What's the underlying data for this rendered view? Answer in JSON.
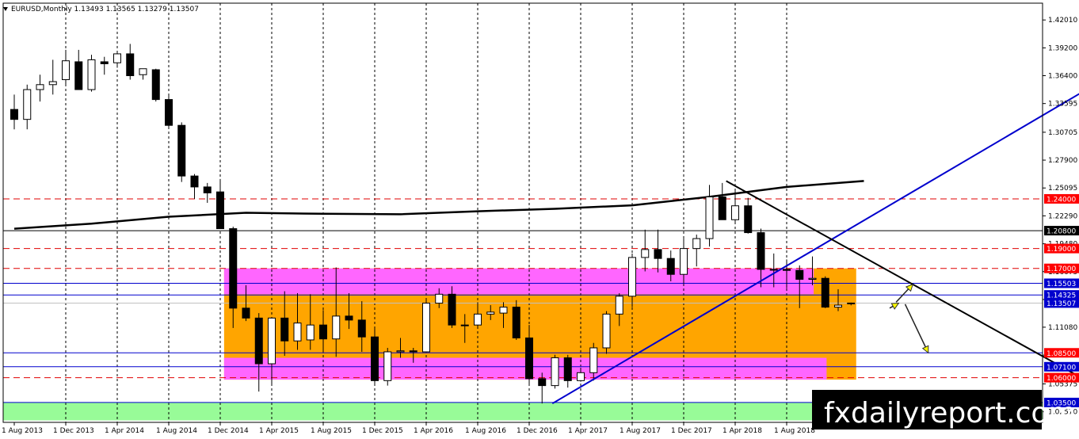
{
  "chart_data": {
    "type": "candlestick",
    "title": "EURUSD,Monthly  1.13493 1.13565 1.13279 1.13507",
    "watermark": "fxdailyreport.com",
    "y_ticks": [
      "1.42010",
      "1.39200",
      "1.36400",
      "1.33595",
      "1.30705",
      "1.27900",
      "1.25095",
      "1.22290",
      "1.19480",
      "1.16675",
      "1.13870",
      "1.11080",
      "1.08270",
      "1.05375",
      "1.02570"
    ],
    "x_ticks": [
      "1 Aug 2013",
      "1 Dec 2013",
      "1 Apr 2014",
      "1 Aug 2014",
      "1 Dec 2014",
      "1 Apr 2015",
      "1 Aug 2015",
      "1 Dec 2015",
      "1 Apr 2016",
      "1 Aug 2016",
      "1 Dec 2016",
      "1 Apr 2017",
      "1 Aug 2017",
      "1 Dec 2017",
      "1 Apr 2018",
      "1 Aug 2018"
    ],
    "ylim": [
      1.015,
      1.437
    ],
    "candles": [
      {
        "o": 1.33,
        "h": 1.345,
        "l": 1.31,
        "c": 1.32
      },
      {
        "o": 1.32,
        "h": 1.355,
        "l": 1.31,
        "c": 1.35
      },
      {
        "o": 1.35,
        "h": 1.365,
        "l": 1.338,
        "c": 1.355
      },
      {
        "o": 1.355,
        "h": 1.38,
        "l": 1.345,
        "c": 1.358
      },
      {
        "o": 1.36,
        "h": 1.39,
        "l": 1.354,
        "c": 1.379
      },
      {
        "o": 1.378,
        "h": 1.39,
        "l": 1.35,
        "c": 1.35
      },
      {
        "o": 1.35,
        "h": 1.385,
        "l": 1.348,
        "c": 1.38
      },
      {
        "o": 1.378,
        "h": 1.383,
        "l": 1.365,
        "c": 1.376
      },
      {
        "o": 1.377,
        "h": 1.388,
        "l": 1.372,
        "c": 1.386
      },
      {
        "o": 1.386,
        "h": 1.396,
        "l": 1.36,
        "c": 1.364
      },
      {
        "o": 1.365,
        "h": 1.371,
        "l": 1.36,
        "c": 1.371
      },
      {
        "o": 1.37,
        "h": 1.371,
        "l": 1.338,
        "c": 1.34
      },
      {
        "o": 1.34,
        "h": 1.345,
        "l": 1.312,
        "c": 1.314
      },
      {
        "o": 1.314,
        "h": 1.317,
        "l": 1.257,
        "c": 1.263
      },
      {
        "o": 1.263,
        "h": 1.265,
        "l": 1.24,
        "c": 1.252
      },
      {
        "o": 1.252,
        "h": 1.256,
        "l": 1.236,
        "c": 1.246
      },
      {
        "o": 1.247,
        "h": 1.26,
        "l": 1.21,
        "c": 1.21
      },
      {
        "o": 1.21,
        "h": 1.212,
        "l": 1.11,
        "c": 1.13
      },
      {
        "o": 1.13,
        "h": 1.153,
        "l": 1.117,
        "c": 1.12
      },
      {
        "o": 1.12,
        "h": 1.125,
        "l": 1.046,
        "c": 1.074
      },
      {
        "o": 1.074,
        "h": 1.119,
        "l": 1.052,
        "c": 1.12
      },
      {
        "o": 1.12,
        "h": 1.147,
        "l": 1.082,
        "c": 1.097
      },
      {
        "o": 1.097,
        "h": 1.145,
        "l": 1.088,
        "c": 1.115
      },
      {
        "o": 1.098,
        "h": 1.144,
        "l": 1.088,
        "c": 1.113
      },
      {
        "o": 1.113,
        "h": 1.128,
        "l": 1.086,
        "c": 1.099
      },
      {
        "o": 1.099,
        "h": 1.171,
        "l": 1.081,
        "c": 1.122
      },
      {
        "o": 1.122,
        "h": 1.145,
        "l": 1.109,
        "c": 1.118
      },
      {
        "o": 1.118,
        "h": 1.137,
        "l": 1.086,
        "c": 1.101
      },
      {
        "o": 1.101,
        "h": 1.11,
        "l": 1.052,
        "c": 1.057
      },
      {
        "o": 1.057,
        "h": 1.09,
        "l": 1.052,
        "c": 1.086
      },
      {
        "o": 1.086,
        "h": 1.1,
        "l": 1.08,
        "c": 1.087
      },
      {
        "o": 1.087,
        "h": 1.09,
        "l": 1.075,
        "c": 1.086
      },
      {
        "o": 1.086,
        "h": 1.138,
        "l": 1.086,
        "c": 1.135
      },
      {
        "o": 1.135,
        "h": 1.15,
        "l": 1.13,
        "c": 1.144
      },
      {
        "o": 1.144,
        "h": 1.152,
        "l": 1.11,
        "c": 1.113
      },
      {
        "o": 1.113,
        "h": 1.124,
        "l": 1.095,
        "c": 1.113
      },
      {
        "o": 1.113,
        "h": 1.136,
        "l": 1.11,
        "c": 1.124
      },
      {
        "o": 1.124,
        "h": 1.133,
        "l": 1.118,
        "c": 1.126
      },
      {
        "o": 1.125,
        "h": 1.136,
        "l": 1.11,
        "c": 1.131
      },
      {
        "o": 1.131,
        "h": 1.138,
        "l": 1.098,
        "c": 1.1
      },
      {
        "o": 1.1,
        "h": 1.113,
        "l": 1.052,
        "c": 1.059
      },
      {
        "o": 1.059,
        "h": 1.065,
        "l": 1.034,
        "c": 1.052
      },
      {
        "o": 1.052,
        "h": 1.083,
        "l": 1.049,
        "c": 1.08
      },
      {
        "o": 1.08,
        "h": 1.083,
        "l": 1.05,
        "c": 1.057
      },
      {
        "o": 1.057,
        "h": 1.07,
        "l": 1.056,
        "c": 1.065
      },
      {
        "o": 1.065,
        "h": 1.095,
        "l": 1.057,
        "c": 1.09
      },
      {
        "o": 1.09,
        "h": 1.127,
        "l": 1.084,
        "c": 1.124
      },
      {
        "o": 1.124,
        "h": 1.145,
        "l": 1.112,
        "c": 1.142
      },
      {
        "o": 1.142,
        "h": 1.185,
        "l": 1.131,
        "c": 1.181
      },
      {
        "o": 1.181,
        "h": 1.209,
        "l": 1.167,
        "c": 1.189
      },
      {
        "o": 1.189,
        "h": 1.209,
        "l": 1.166,
        "c": 1.18
      },
      {
        "o": 1.18,
        "h": 1.188,
        "l": 1.157,
        "c": 1.164
      },
      {
        "o": 1.164,
        "h": 1.2,
        "l": 1.155,
        "c": 1.19
      },
      {
        "o": 1.19,
        "h": 1.204,
        "l": 1.172,
        "c": 1.2
      },
      {
        "o": 1.2,
        "h": 1.254,
        "l": 1.192,
        "c": 1.242
      },
      {
        "o": 1.242,
        "h": 1.256,
        "l": 1.22,
        "c": 1.219
      },
      {
        "o": 1.219,
        "h": 1.248,
        "l": 1.215,
        "c": 1.233
      },
      {
        "o": 1.233,
        "h": 1.241,
        "l": 1.205,
        "c": 1.206
      },
      {
        "o": 1.206,
        "h": 1.21,
        "l": 1.151,
        "c": 1.169
      },
      {
        "o": 1.169,
        "h": 1.185,
        "l": 1.151,
        "c": 1.169
      },
      {
        "o": 1.169,
        "h": 1.179,
        "l": 1.15,
        "c": 1.168
      },
      {
        "o": 1.168,
        "h": 1.173,
        "l": 1.13,
        "c": 1.159
      },
      {
        "o": 1.159,
        "h": 1.182,
        "l": 1.153,
        "c": 1.16
      },
      {
        "o": 1.16,
        "h": 1.162,
        "l": 1.13,
        "c": 1.131
      },
      {
        "o": 1.131,
        "h": 1.149,
        "l": 1.127,
        "c": 1.133
      },
      {
        "o": 1.1349,
        "h": 1.1356,
        "l": 1.1328,
        "c": 1.1351
      }
    ],
    "moving_average": [
      {
        "i": 0,
        "v": 1.21
      },
      {
        "i": 6,
        "v": 1.215
      },
      {
        "i": 12,
        "v": 1.222
      },
      {
        "i": 18,
        "v": 1.226
      },
      {
        "i": 24,
        "v": 1.225
      },
      {
        "i": 30,
        "v": 1.2245
      },
      {
        "i": 36,
        "v": 1.2275
      },
      {
        "i": 42,
        "v": 1.23
      },
      {
        "i": 48,
        "v": 1.2335
      },
      {
        "i": 54,
        "v": 1.242
      },
      {
        "i": 60,
        "v": 1.252
      },
      {
        "i": 66,
        "v": 1.258
      }
    ],
    "zones": [
      {
        "color": "#ffa500",
        "x0": 16.3,
        "x1": 65.4,
        "y0": 1.058,
        "y1": 1.17
      },
      {
        "color": "#ff66ff",
        "x0": 16.3,
        "x1": 62.1,
        "y0": 1.144,
        "y1": 1.17
      },
      {
        "color": "#ff66ff",
        "x0": 16.3,
        "x1": 63.1,
        "y0": 1.058,
        "y1": 1.08
      },
      {
        "color": "#98fb98",
        "x0": -1,
        "x1": 80,
        "y0": 1.017,
        "y1": 1.035
      }
    ],
    "dashed_levels": [
      "1.24000",
      "1.19000",
      "1.17000",
      "1.06000"
    ],
    "solid_levels": [
      {
        "value": "1.20800",
        "color": "#000000"
      },
      {
        "value": "1.15503",
        "color": "#0000cd"
      },
      {
        "value": "1.14325",
        "color": "#0000cd"
      },
      {
        "value": "1.08500",
        "color": "#0000cd"
      },
      {
        "value": "1.07100",
        "color": "#0000cd"
      },
      {
        "value": "1.03500",
        "color": "#0000cd"
      }
    ],
    "price_labels": [
      {
        "text": "1.24000",
        "value": 1.24,
        "bg": "#ff0000"
      },
      {
        "text": "1.20800",
        "value": 1.208,
        "bg": "#000000"
      },
      {
        "text": "1.19000",
        "value": 1.19,
        "bg": "#ff0000"
      },
      {
        "text": "1.17000",
        "value": 1.17,
        "bg": "#ff0000"
      },
      {
        "text": "1.15503",
        "value": 1.155,
        "bg": "#0000cd"
      },
      {
        "text": "1.14325",
        "value": 1.1433,
        "bg": "#0000cd"
      },
      {
        "text": "1.13507",
        "value": 1.1351,
        "bg": "#0000cd"
      },
      {
        "text": "1.08500",
        "value": 1.085,
        "bg": "#ff0000"
      },
      {
        "text": "1.07100",
        "value": 1.071,
        "bg": "#0000cd"
      },
      {
        "text": "1.06000",
        "value": 1.06,
        "bg": "#ff0000"
      },
      {
        "text": "1.03500",
        "value": 1.035,
        "bg": "#0000cd"
      }
    ],
    "trendlines": [
      {
        "color": "#0000cd",
        "i0": 41.8,
        "v0": 1.034,
        "i1": 85,
        "v1": 1.363
      },
      {
        "color": "#000000",
        "i0": 55.3,
        "v0": 1.258,
        "i1": 84,
        "v1": 1.052
      }
    ],
    "arrows": [
      {
        "i0": 68.0,
        "v0": 1.13,
        "i1": 68.7,
        "v1": 1.135
      },
      {
        "i0": 68.5,
        "v0": 1.136,
        "i1": 69.8,
        "v1": 1.154
      },
      {
        "i0": 69.2,
        "v0": 1.134,
        "i1": 71.0,
        "v1": 1.085
      }
    ],
    "colors": {
      "bull": "#ffffff",
      "bear": "#000000",
      "grid": "#000000",
      "background": "#ffffff"
    }
  }
}
